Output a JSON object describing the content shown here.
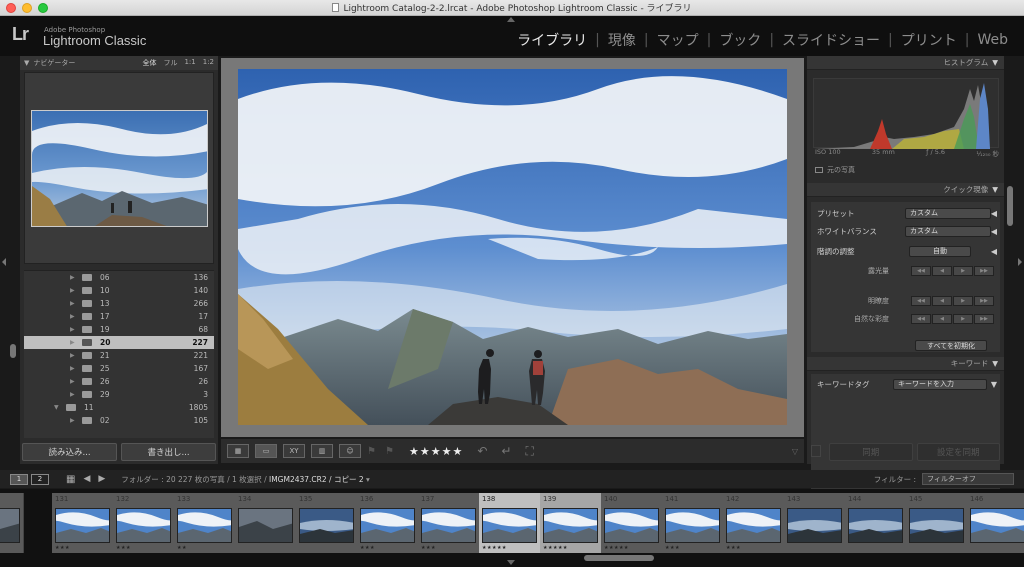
{
  "window": {
    "title": "Lightroom Catalog-2-2.lrcat - Adobe Photoshop Lightroom Classic - ライブラリ"
  },
  "logo": {
    "mark": "Lr",
    "small": "Adobe Photoshop",
    "big": "Lightroom Classic"
  },
  "modules": [
    {
      "label": "ライブラリ",
      "active": true
    },
    {
      "label": "現像"
    },
    {
      "label": "マップ"
    },
    {
      "label": "ブック"
    },
    {
      "label": "スライドショー"
    },
    {
      "label": "プリント"
    },
    {
      "label": "Web"
    }
  ],
  "navigator": {
    "title": "ナビゲーター",
    "zooms": [
      "全体",
      "フル",
      "1:1",
      "1:2"
    ],
    "active_zoom": "全体"
  },
  "folders": [
    {
      "name": "06",
      "count": "136"
    },
    {
      "name": "10",
      "count": "140"
    },
    {
      "name": "13",
      "count": "266"
    },
    {
      "name": "17",
      "count": "17"
    },
    {
      "name": "19",
      "count": "68"
    },
    {
      "name": "20",
      "count": "227",
      "selected": true
    },
    {
      "name": "21",
      "count": "221"
    },
    {
      "name": "25",
      "count": "167"
    },
    {
      "name": "26",
      "count": "26"
    },
    {
      "name": "29",
      "count": "3"
    },
    {
      "name": "11",
      "count": "1805",
      "level": 1,
      "expanded": true
    },
    {
      "name": "02",
      "count": "105"
    }
  ],
  "left_buttons": {
    "import": "読み込み...",
    "export": "書き出し..."
  },
  "toolbar": {
    "stars": "★★★★★"
  },
  "histogram": {
    "title": "ヒストグラム",
    "exif": {
      "iso": "ISO 100",
      "focal": "35 mm",
      "aperture": "ƒ / 5.6",
      "shutter": "¹⁄₁₂₅₀ 秒"
    },
    "original": "元の写真"
  },
  "quick_develop": {
    "title": "クイック現像",
    "preset_label": "プリセット",
    "preset_value": "カスタム",
    "wb_label": "ホワイトバランス",
    "wb_value": "カスタム",
    "tone_label": "階調の調整",
    "auto_label": "自動",
    "exposure_label": "露光量",
    "clarity_label": "明瞭度",
    "vibrance_label": "自然な彩度",
    "reset_label": "すべてを初期化"
  },
  "keywords": {
    "title": "キーワード",
    "tag_label": "キーワードタグ",
    "tag_value": "キーワードを入力"
  },
  "right_buttons": {
    "sync": "同期",
    "sync_settings": "設定を同期"
  },
  "filmstrip_bar": {
    "screen1": "1",
    "screen2": "2",
    "path_prefix": "フォルダー : 20",
    "path_mid": "227 枚の写真 / 1 枚選択 /",
    "file": "IMGM2437.CR2",
    "copy": "/ コピー 2",
    "filter_label": "フィルター :",
    "filter_value": "フィルターオフ"
  },
  "filmstrip": [
    {
      "num": "",
      "stars": "",
      "scene": "dark"
    },
    {
      "num": "131",
      "stars": "★★★",
      "scene": "sky"
    },
    {
      "num": "132",
      "stars": "★★★",
      "scene": "sky"
    },
    {
      "num": "133",
      "stars": "★★",
      "scene": "sky"
    },
    {
      "num": "134",
      "stars": "",
      "scene": "dark"
    },
    {
      "num": "135",
      "stars": "",
      "scene": "dusk"
    },
    {
      "num": "136",
      "stars": "★★★",
      "scene": "sky"
    },
    {
      "num": "137",
      "stars": "★★★",
      "scene": "sky"
    },
    {
      "num": "138",
      "stars": "★★★★★",
      "scene": "sky",
      "selected": true
    },
    {
      "num": "139",
      "stars": "★★★★★",
      "scene": "sky"
    },
    {
      "num": "140",
      "stars": "★★★★★",
      "scene": "sky"
    },
    {
      "num": "141",
      "stars": "★★★",
      "scene": "sky"
    },
    {
      "num": "142",
      "stars": "★★★",
      "scene": "sky"
    },
    {
      "num": "143",
      "stars": "",
      "scene": "dusk"
    },
    {
      "num": "144",
      "stars": "",
      "scene": "dusk"
    },
    {
      "num": "145",
      "stars": "",
      "scene": "dusk"
    },
    {
      "num": "146",
      "stars": "",
      "scene": "sky"
    }
  ]
}
